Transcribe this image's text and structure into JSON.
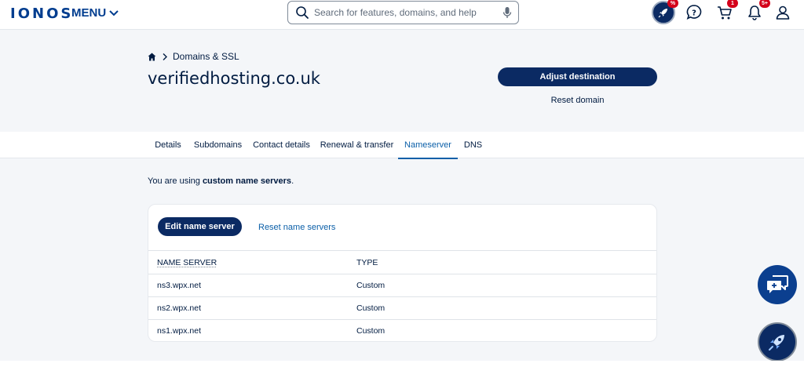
{
  "header": {
    "logo": "IONOS",
    "menu_label": "MENU",
    "search_placeholder": "Search for features, domains, and help",
    "badges": {
      "promo": "%",
      "cart": "1",
      "notifications": "5+"
    }
  },
  "page": {
    "breadcrumb": "Domains & SSL",
    "domain": "verifiedhosting.co.uk",
    "adjust_button": "Adjust destination",
    "reset_domain": "Reset domain"
  },
  "tabs": [
    {
      "label": "Details",
      "active": false
    },
    {
      "label": "Subdomains",
      "active": false
    },
    {
      "label": "Contact details",
      "active": false
    },
    {
      "label": "Renewal & transfer",
      "active": false
    },
    {
      "label": "Nameserver",
      "active": true
    },
    {
      "label": "DNS",
      "active": false
    }
  ],
  "info": {
    "prefix": "You are using ",
    "bold": "custom name servers",
    "suffix": "."
  },
  "card": {
    "edit_button": "Edit name server",
    "reset_link": "Reset name servers",
    "columns": [
      "NAME SERVER",
      "TYPE"
    ],
    "rows": [
      {
        "name": "ns3.wpx.net",
        "type": "Custom"
      },
      {
        "name": "ns2.wpx.net",
        "type": "Custom"
      },
      {
        "name": "ns1.wpx.net",
        "type": "Custom"
      }
    ]
  },
  "colors": {
    "brand": "#003d8f",
    "primary_button": "#0b2a63",
    "link": "#0b5fa8",
    "badge": "#d4001a",
    "background": "#f4f6f9"
  },
  "icons": [
    "search-icon",
    "microphone-icon",
    "rocket-icon",
    "help-chat-icon",
    "cart-icon",
    "bell-icon",
    "user-icon",
    "home-icon",
    "chevron-right-icon",
    "chevron-down-icon",
    "chat-bubbles-icon"
  ]
}
